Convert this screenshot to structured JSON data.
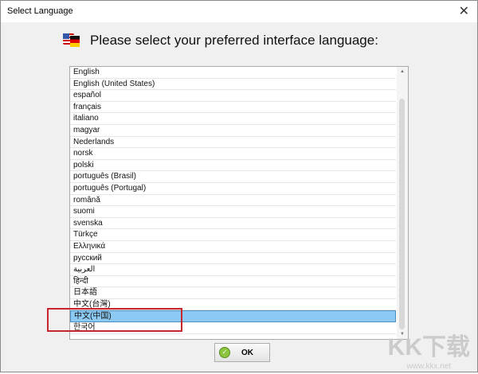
{
  "window": {
    "title": "Select Language",
    "close": "✕"
  },
  "heading": "Please select your preferred interface language:",
  "languages": [
    "English",
    "English (United States)",
    "español",
    "français",
    "italiano",
    "magyar",
    "Nederlands",
    "norsk",
    "polski",
    "português (Brasil)",
    "português (Portugal)",
    "română",
    "suomi",
    "svenska",
    "Türkçe",
    "Ελληνικά",
    "русский",
    "العربية",
    "हिन्दी",
    "日本語",
    "中文(台灣)",
    "中文(中国)",
    "한국어"
  ],
  "selected_index": 21,
  "ok_label": "OK",
  "watermark": {
    "big": "KK下载",
    "small": "www.kkx.net"
  }
}
